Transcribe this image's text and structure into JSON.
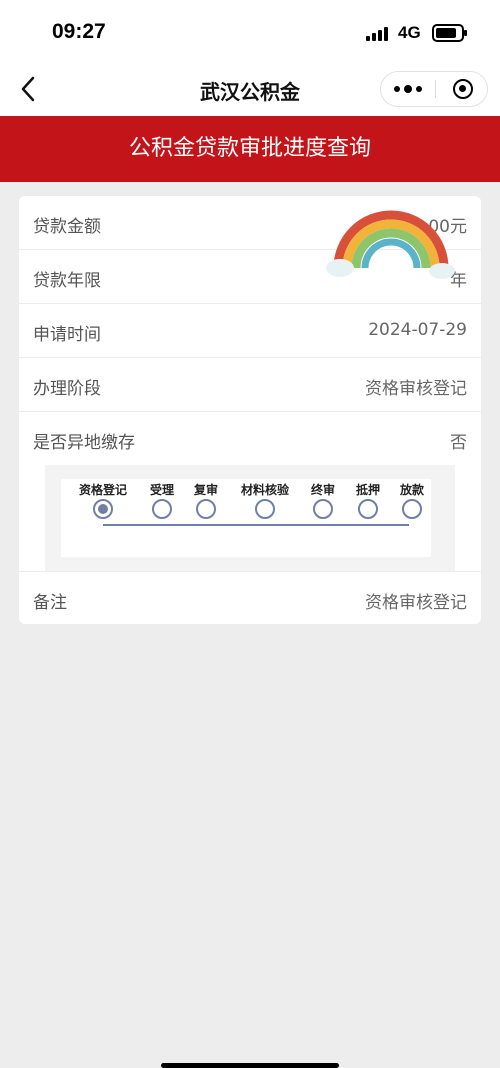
{
  "status_bar": {
    "time": "09:27",
    "network": "4G"
  },
  "nav": {
    "title": "武汉公积金"
  },
  "banner": {
    "title": "公积金贷款审批进度查询"
  },
  "details": {
    "loan_amount": {
      "label": "贷款金额",
      "value": "0.00元"
    },
    "loan_term": {
      "label": "贷款年限",
      "value": "年"
    },
    "apply_time": {
      "label": "申请时间",
      "value": "2024-07-29"
    },
    "stage": {
      "label": "办理阶段",
      "value": "资格审核登记"
    },
    "remote_payment": {
      "label": "是否异地缴存",
      "value": "否"
    },
    "remark": {
      "label": "备注",
      "value": "资格审核登记"
    }
  },
  "progress": {
    "steps": [
      "资格登记",
      "受理",
      "复审",
      "材料核验",
      "终审",
      "抵押",
      "放款"
    ],
    "current_step": 1,
    "color": "#6f7fa6"
  },
  "colors": {
    "banner": "#c3141a",
    "page_bg": "#ededed"
  }
}
